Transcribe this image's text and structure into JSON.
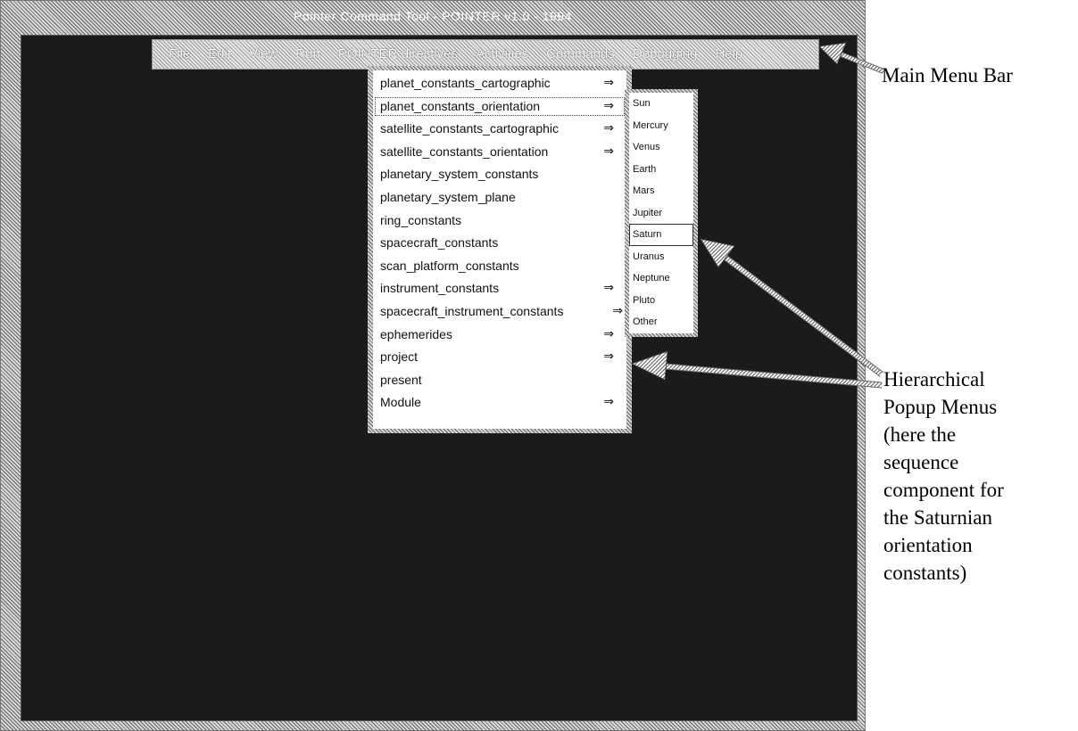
{
  "window": {
    "title": "Pointer Command Tool - POINTER v1.0 - 1994"
  },
  "menubar": {
    "items": [
      {
        "label": "File"
      },
      {
        "label": "Edit"
      },
      {
        "label": "View"
      },
      {
        "label": "Run"
      },
      {
        "label": "POINTER directives"
      },
      {
        "label": "Activities"
      },
      {
        "label": "Commands"
      },
      {
        "label": "Debugging"
      },
      {
        "label": "Help"
      }
    ]
  },
  "dropdown": {
    "items": [
      {
        "label": "planet_constants_cartographic",
        "arrow": "⇒"
      },
      {
        "label": "planet_constants_orientation",
        "arrow": "⇒"
      },
      {
        "label": "satellite_constants_cartographic",
        "arrow": "⇒"
      },
      {
        "label": "satellite_constants_orientation",
        "arrow": "⇒"
      },
      {
        "label": "planetary_system_constants",
        "arrow": ""
      },
      {
        "label": "planetary_system_plane",
        "arrow": ""
      },
      {
        "label": "ring_constants",
        "arrow": ""
      },
      {
        "label": "spacecraft_constants",
        "arrow": ""
      },
      {
        "label": "scan_platform_constants",
        "arrow": ""
      },
      {
        "label": "instrument_constants",
        "arrow": "⇒"
      },
      {
        "label": "spacecraft_instrument_constants",
        "arrow": "⇒"
      },
      {
        "label": "ephemerides",
        "arrow": "⇒"
      },
      {
        "label": "project",
        "arrow": "⇒"
      },
      {
        "label": "present",
        "arrow": ""
      },
      {
        "label": "Module",
        "arrow": "⇒"
      }
    ]
  },
  "submenu": {
    "items": [
      "Sun",
      "Mercury",
      "Venus",
      "Earth",
      "Mars",
      "Jupiter",
      "Saturn",
      "Uranus",
      "Neptune",
      "Pluto",
      "Other"
    ],
    "selected": "Saturn"
  },
  "annotations": {
    "menubar_label": "Main Menu Bar",
    "popup_lines": [
      "Hierarchical",
      "Popup Menus",
      "(here the",
      "sequence",
      "component for",
      "the Saturnian",
      "orientation",
      "constants)"
    ]
  },
  "icons": {
    "submenu_arrow": "double-right-arrow-icon"
  }
}
